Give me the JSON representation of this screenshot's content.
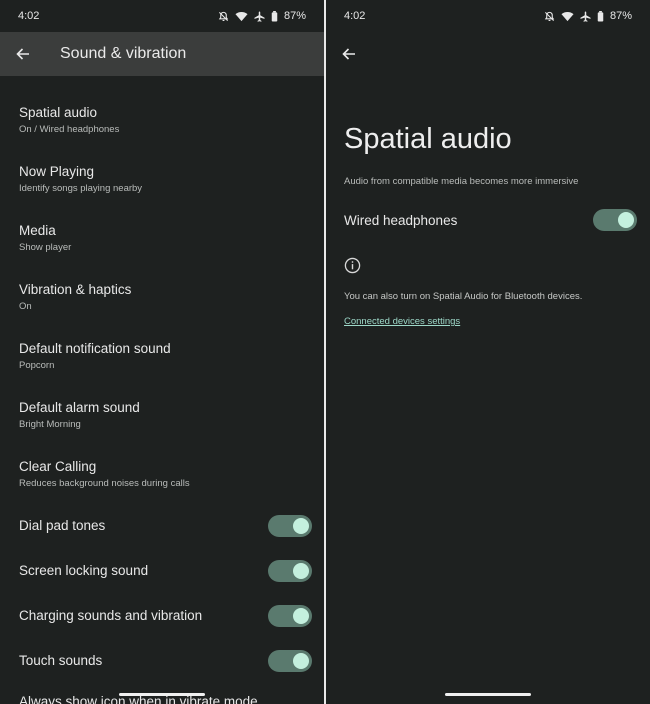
{
  "left": {
    "status": {
      "time": "4:02",
      "battery": "87%"
    },
    "title": "Sound & vibration",
    "items": [
      {
        "title": "Spatial audio",
        "subtitle": "On / Wired headphones"
      },
      {
        "title": "Now Playing",
        "subtitle": "Identify songs playing nearby"
      },
      {
        "title": "Media",
        "subtitle": "Show player"
      },
      {
        "title": "Vibration & haptics",
        "subtitle": "On"
      },
      {
        "title": "Default notification sound",
        "subtitle": "Popcorn"
      },
      {
        "title": "Default alarm sound",
        "subtitle": "Bright Morning"
      },
      {
        "title": "Clear Calling",
        "subtitle": "Reduces background noises during calls"
      }
    ],
    "toggles": [
      {
        "title": "Dial pad tones",
        "on": true
      },
      {
        "title": "Screen locking sound",
        "on": true
      },
      {
        "title": "Charging sounds and vibration",
        "on": true
      },
      {
        "title": "Touch sounds",
        "on": true
      }
    ],
    "cut_off_item": "Always show icon when in vibrate mode"
  },
  "right": {
    "status": {
      "time": "4:02",
      "battery": "87%"
    },
    "title": "Spatial audio",
    "description": "Audio from compatible media becomes more immersive",
    "toggle": {
      "title": "Wired headphones",
      "on": true
    },
    "note": "You can also turn on Spatial Audio for Bluetooth devices.",
    "link": "Connected devices settings"
  },
  "colors": {
    "background": "#1e2120",
    "accent": "#c4f0de",
    "toggle_track": "#5a7a6e",
    "link": "#9ed9c9"
  }
}
